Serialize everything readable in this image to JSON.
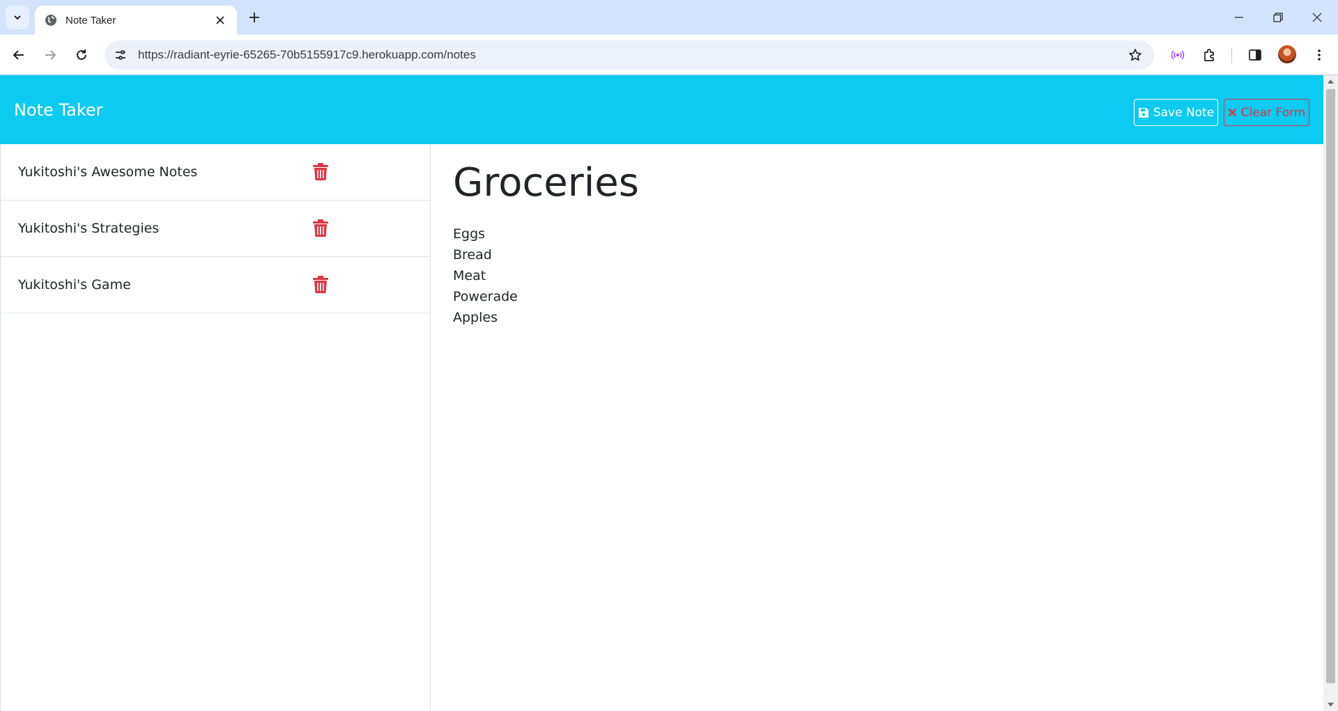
{
  "browser": {
    "tab_title": "Note Taker",
    "url": "https://radiant-eyrie-65265-70b5155917c9.herokuapp.com/notes"
  },
  "app": {
    "brand": "Note Taker",
    "save_label": "Save Note",
    "clear_label": "Clear Form"
  },
  "notes": [
    {
      "title": "Yukitoshi's Awesome Notes"
    },
    {
      "title": "Yukitoshi's Strategies"
    },
    {
      "title": "Yukitoshi's Game"
    }
  ],
  "active_note": {
    "title": "Groceries",
    "text": "Eggs\nBread\nMeat\nPowerade\nApples"
  },
  "colors": {
    "navbar": "#0dcaf0",
    "danger": "#dc3545",
    "chrome_tabstrip": "#d3e3fd"
  }
}
